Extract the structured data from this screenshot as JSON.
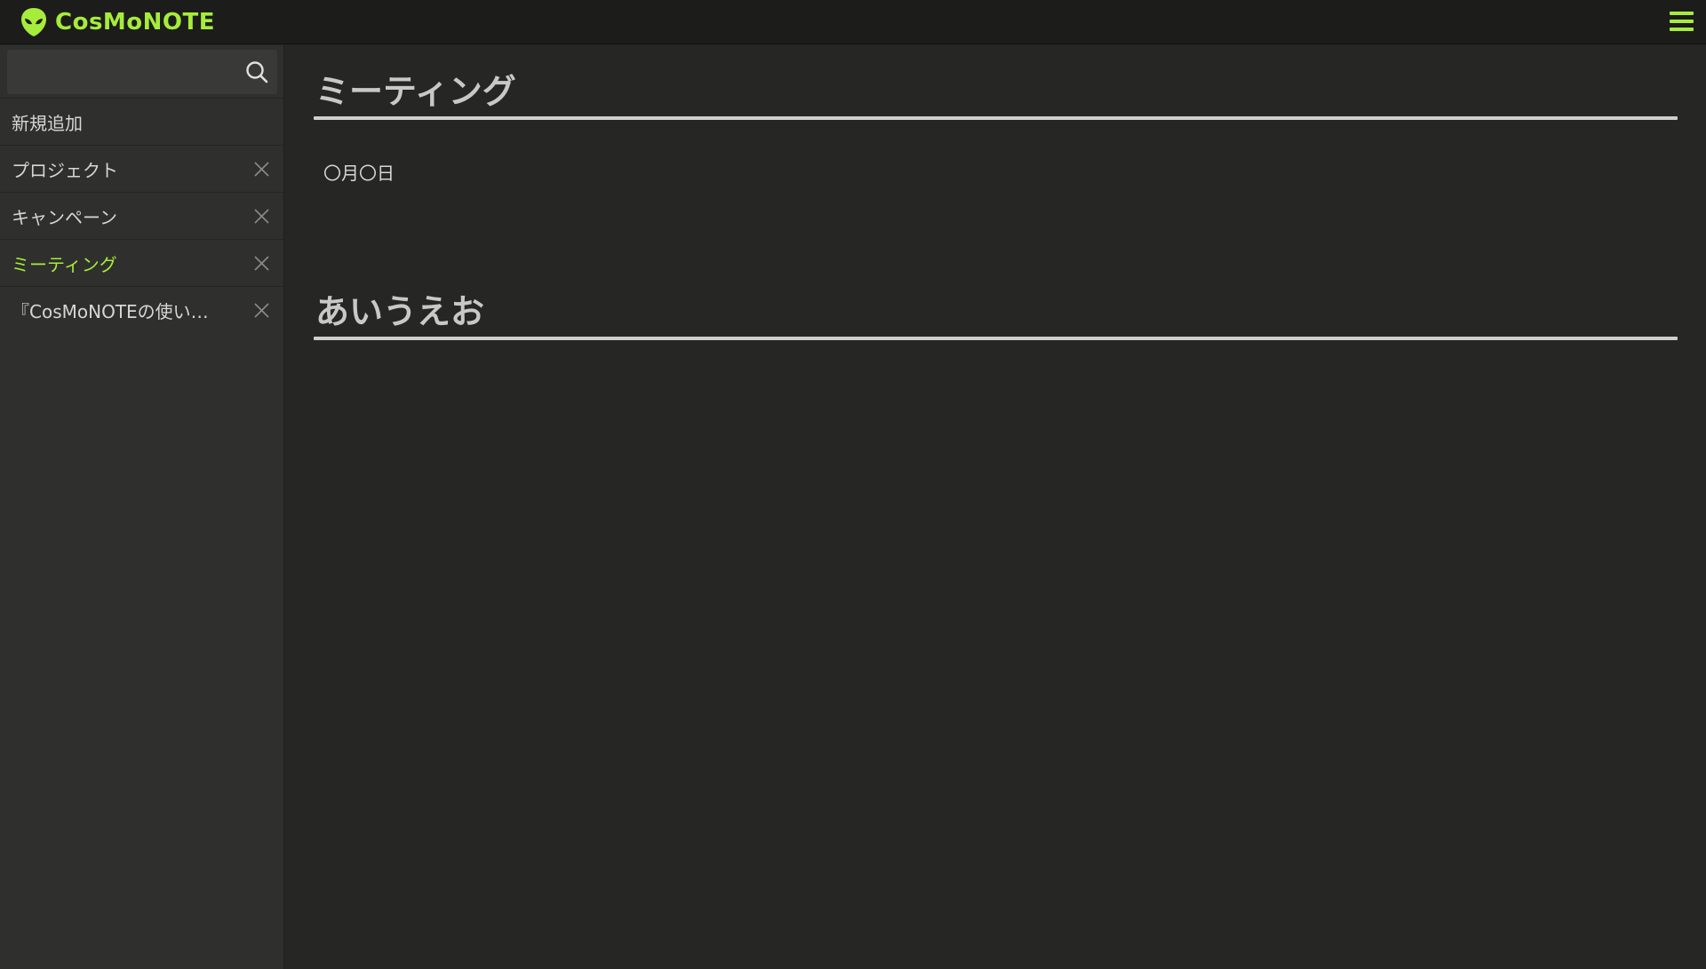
{
  "app": {
    "brand_name": "CosMoNOTE",
    "accent_color": "#a6ec3a"
  },
  "header": {
    "logo_icon": "alien-icon",
    "menu_icon": "hamburger-menu-icon"
  },
  "sidebar": {
    "search": {
      "value": "",
      "placeholder": "",
      "icon": "search-icon"
    },
    "items": [
      {
        "label": "新規追加",
        "closable": false,
        "active": false
      },
      {
        "label": "プロジェクト",
        "closable": true,
        "active": false
      },
      {
        "label": "キャンペーン",
        "closable": true,
        "active": false
      },
      {
        "label": "ミーティング",
        "closable": true,
        "active": true
      },
      {
        "label": "『CosMoNOTEの使い…",
        "closable": true,
        "active": false
      }
    ]
  },
  "main": {
    "sections": [
      {
        "title": "ミーティング",
        "body": "〇月〇日"
      },
      {
        "title": "あいうえお",
        "body": ""
      }
    ]
  }
}
